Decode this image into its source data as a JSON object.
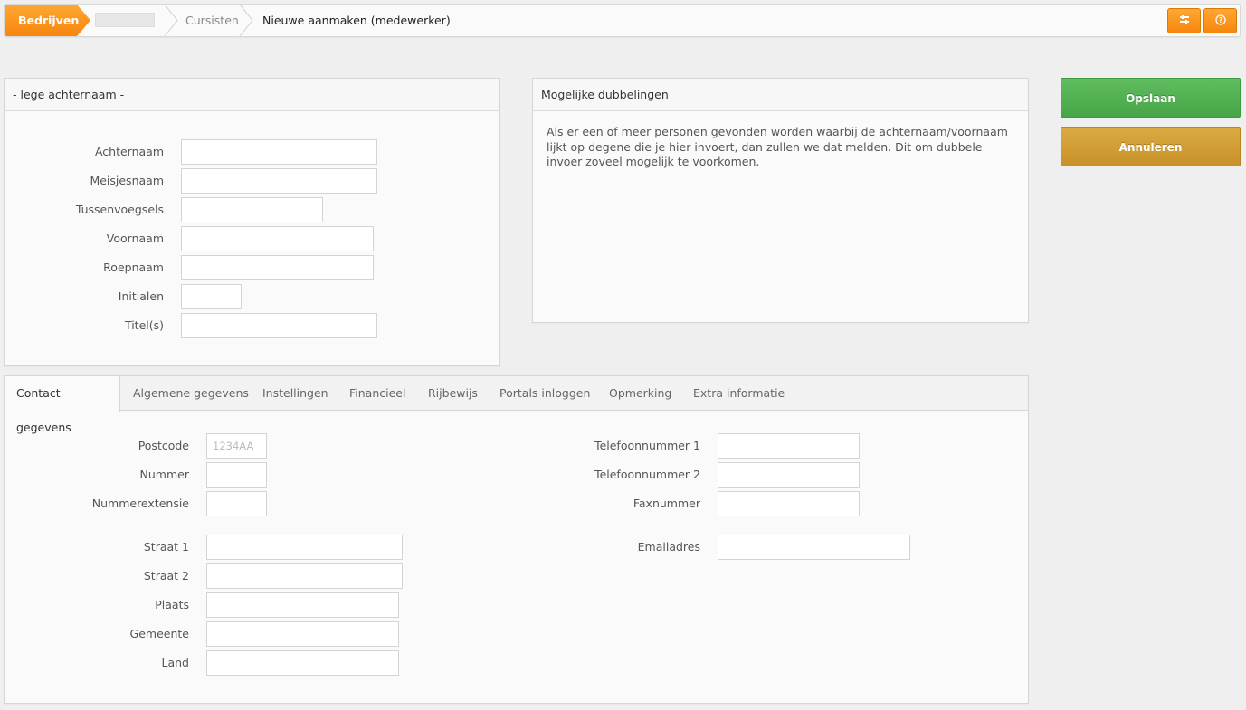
{
  "breadcrumb": {
    "root": "Bedrijven",
    "level2": "Cursisten",
    "current": "Nieuwe aanmaken (medewerker)"
  },
  "toolbar": {
    "settings_icon": "sliders-icon",
    "help_icon": "help-circle-icon"
  },
  "name_panel": {
    "title": "- lege achternaam -",
    "fields": [
      {
        "label": "Achternaam",
        "value": ""
      },
      {
        "label": "Meisjesnaam",
        "value": ""
      },
      {
        "label": "Tussenvoegsels",
        "value": ""
      },
      {
        "label": "Voornaam",
        "value": ""
      },
      {
        "label": "Roepnaam",
        "value": ""
      },
      {
        "label": "Initialen",
        "value": ""
      },
      {
        "label": "Titel(s)",
        "value": ""
      }
    ]
  },
  "duplicates_panel": {
    "title": "Mogelijke dubbelingen",
    "text": "Als er een of meer personen gevonden worden waarbij de achternaam/voornaam lijkt op degene die je hier invoert, dan zullen we dat melden. Dit om dubbele invoer zoveel mogelijk te voorkomen."
  },
  "actions": {
    "save": "Opslaan",
    "cancel": "Annuleren"
  },
  "tabs": [
    "Contact gegevens",
    "Algemene gegevens",
    "Instellingen",
    "Financieel",
    "Rijbewijs",
    "Portals inloggen",
    "Opmerking",
    "Extra informatie"
  ],
  "contact": {
    "left": [
      {
        "label": "Postcode",
        "value": "",
        "placeholder": "1234AA"
      },
      {
        "label": "Nummer",
        "value": ""
      },
      {
        "label": "Nummerextensie",
        "value": ""
      },
      {
        "label": "Straat 1",
        "value": ""
      },
      {
        "label": "Straat 2",
        "value": ""
      },
      {
        "label": "Plaats",
        "value": ""
      },
      {
        "label": "Gemeente",
        "value": ""
      },
      {
        "label": "Land",
        "value": ""
      }
    ],
    "right": [
      {
        "label": "Telefoonnummer 1",
        "value": ""
      },
      {
        "label": "Telefoonnummer 2",
        "value": ""
      },
      {
        "label": "Faxnummer",
        "value": ""
      },
      {
        "label": "Emailadres",
        "value": ""
      }
    ]
  },
  "colors": {
    "accent_orange": "#f7860d",
    "save_green": "#46a546",
    "cancel_gold": "#c8922a"
  }
}
